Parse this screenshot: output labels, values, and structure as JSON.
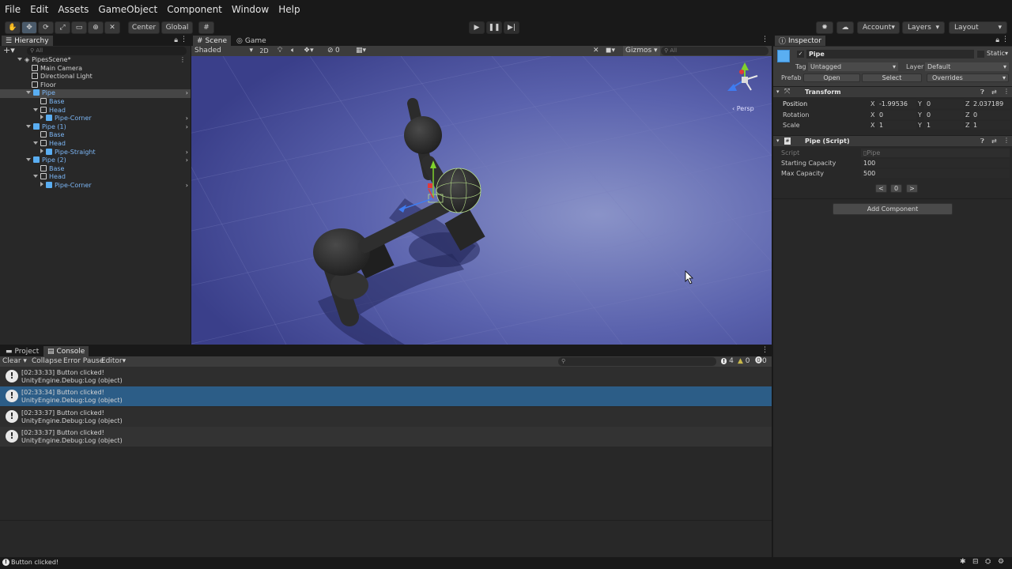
{
  "menu": [
    "File",
    "Edit",
    "Assets",
    "GameObject",
    "Component",
    "Window",
    "Help"
  ],
  "toolbar": {
    "center": "Center",
    "global": "Global",
    "account": "Account",
    "layers": "Layers",
    "layout": "Layout"
  },
  "hierarchy": {
    "tab": "Hierarchy",
    "search_placeholder": "All",
    "items": [
      {
        "label": "PipesScene*"
      },
      {
        "label": "Main Camera"
      },
      {
        "label": "Directional Light"
      },
      {
        "label": "Floor"
      },
      {
        "label": "Pipe"
      },
      {
        "label": "Base"
      },
      {
        "label": "Head"
      },
      {
        "label": "Pipe-Corner"
      },
      {
        "label": "Pipe (1)"
      },
      {
        "label": "Base"
      },
      {
        "label": "Head"
      },
      {
        "label": "Pipe-Straight"
      },
      {
        "label": "Pipe (2)"
      },
      {
        "label": "Base"
      },
      {
        "label": "Head"
      },
      {
        "label": "Pipe-Corner"
      }
    ]
  },
  "scene": {
    "tab_scene": "Scene",
    "tab_game": "Game",
    "shading": "Shaded",
    "mode2d": "2D",
    "hidden_count": "0",
    "gizmos": "Gizmos",
    "search_placeholder": "All",
    "persp": "‹ Persp"
  },
  "bottom": {
    "tab_project": "Project",
    "tab_console": "Console",
    "clear": "Clear",
    "collapse": "Collapse",
    "error_pause": "Error Pause",
    "editor": "Editor",
    "count_logs": "4",
    "count_warn": "0",
    "count_err": "0",
    "logs": [
      {
        "line1": "[02:33:33] Button clicked!",
        "line2": "UnityEngine.Debug:Log (object)"
      },
      {
        "line1": "[02:33:34] Button clicked!",
        "line2": "UnityEngine.Debug:Log (object)"
      },
      {
        "line1": "[02:33:37] Button clicked!",
        "line2": "UnityEngine.Debug:Log (object)"
      },
      {
        "line1": "[02:33:37] Button clicked!",
        "line2": "UnityEngine.Debug:Log (object)"
      }
    ]
  },
  "inspector": {
    "tab": "Inspector",
    "name": "Pipe",
    "static": "Static",
    "tag_label": "Tag",
    "tag_value": "Untagged",
    "layer_label": "Layer",
    "layer_value": "Default",
    "prefab_label": "Prefab",
    "open": "Open",
    "select": "Select",
    "overrides": "Overrides",
    "transform": {
      "title": "Transform",
      "position_label": "Position",
      "rotation_label": "Rotation",
      "scale_label": "Scale",
      "axis_x": "X",
      "axis_y": "Y",
      "axis_z": "Z",
      "pos": [
        "-1.99536",
        "0",
        "2.037189"
      ],
      "rot": [
        "0",
        "0",
        "0"
      ],
      "scl": [
        "1",
        "1",
        "1"
      ]
    },
    "script": {
      "title": "Pipe (Script)",
      "script_label": "Script",
      "script_value": "Pipe",
      "starting_label": "Starting Capacity",
      "starting_value": "100",
      "max_label": "Max Capacity",
      "max_value": "500",
      "btn_prev": "<",
      "btn_zero": "0",
      "btn_next": ">"
    },
    "add_component": "Add Component"
  },
  "status": {
    "message": "Button clicked!"
  },
  "colors": {
    "accent": "#2c5d87",
    "scene_bg": "#4a4f9a"
  }
}
